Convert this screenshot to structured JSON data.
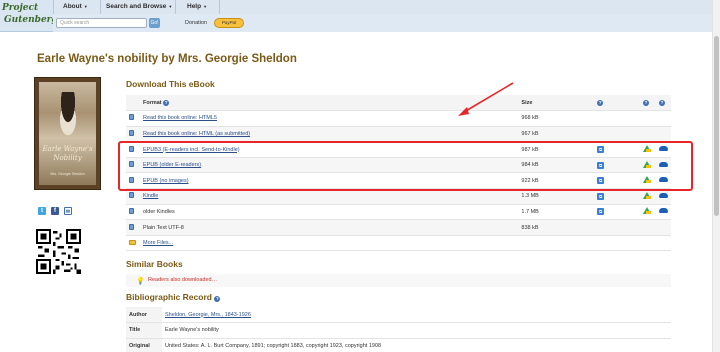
{
  "header": {
    "logo_line1": "Project",
    "logo_line2": "Gutenberg",
    "nav": [
      {
        "label": "About"
      },
      {
        "label": "Search and Browse"
      },
      {
        "label": "Help"
      }
    ],
    "search_placeholder": "Quick search",
    "go_label": "Go!",
    "donation_label": "Donation",
    "donate_button": "PayPal"
  },
  "book": {
    "title": "Earle Wayne's nobility by Mrs. Georgie Sheldon",
    "cover_line1": "Earle Wayne's",
    "cover_line2": "Nobility",
    "cover_author": "Mrs. Georgie Sheldon"
  },
  "download": {
    "heading": "Download This eBook",
    "col_format": "Format",
    "col_size": "Size",
    "rows": [
      {
        "label": "Read this book online: HTML5",
        "size": "968 kB",
        "link": true
      },
      {
        "label": "Read this book online: HTML (as submitted)",
        "size": "967 kB",
        "link": true
      },
      {
        "label": "EPUB3 (E-readers incl. Send-to-Kindle)",
        "size": "987 kB",
        "link": true
      },
      {
        "label": "EPUB (older E-readers)",
        "size": "984 kB",
        "link": true
      },
      {
        "label": "EPUB (no images)",
        "size": "922 kB",
        "link": true
      },
      {
        "label": "Kindle",
        "size": "1.3 MB",
        "link": true
      },
      {
        "label": "older Kindles",
        "size": "1.7 MB",
        "link": false
      },
      {
        "label": "Plain Text UTF-8",
        "size": "838 kB",
        "link": false
      },
      {
        "label": "More Files...",
        "size": "",
        "link": true
      }
    ]
  },
  "similar": {
    "heading": "Similar Books",
    "link": "Readers also downloaded…"
  },
  "biblio": {
    "heading": "Bibliographic Record",
    "rows": [
      {
        "key": "Author",
        "value": "Sheldon, Georgie, Mrs., 1843-1926"
      },
      {
        "key": "Title",
        "value": "Earle Wayne's nobility"
      },
      {
        "key": "Original",
        "value": "United States: A. L. Burt Company, 1891; copyright 1883, copyright 1923, copyright 1908"
      }
    ]
  },
  "colors": {
    "accent": "#7a5a16",
    "annotation": "#e8262a",
    "link": "#2b4f8a"
  }
}
